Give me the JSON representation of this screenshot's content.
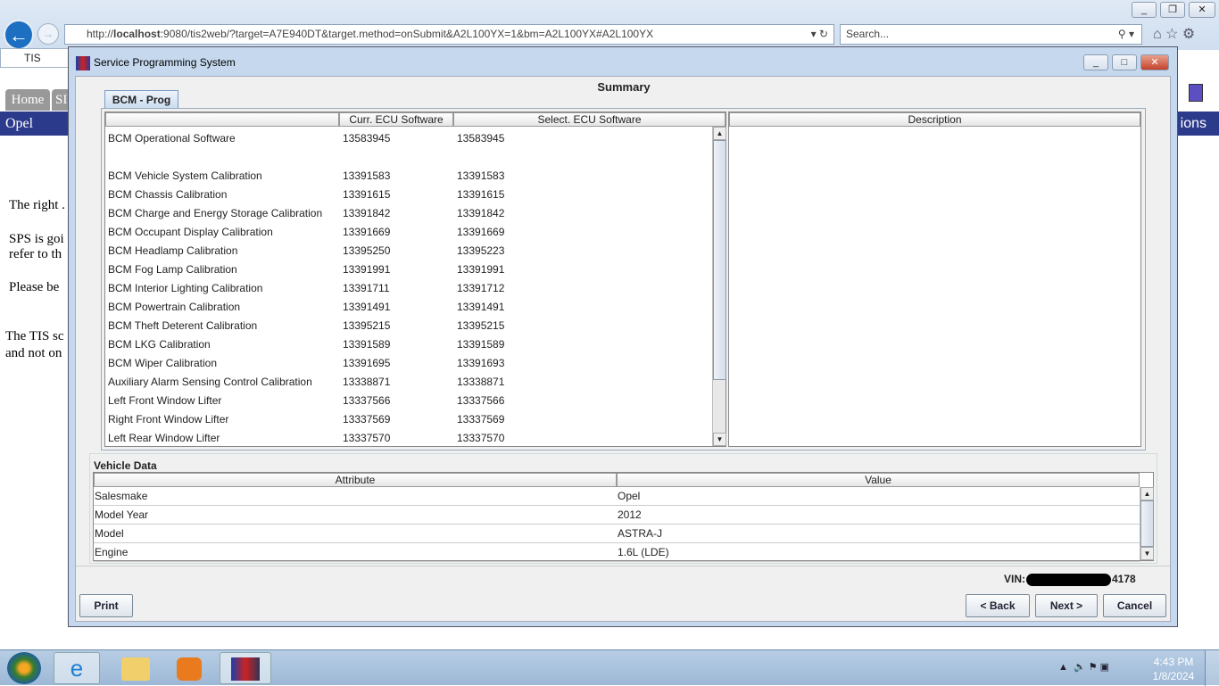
{
  "browser": {
    "url_prefix": "http://",
    "url_host": "localhost",
    "url_rest": ":9080/tis2web/?target=A7E940DT&target.method=onSubmit&A2L100YX=1&bm=A2L100YX#A2L100YX",
    "search_placeholder": "Search...",
    "tab_title": "TIS"
  },
  "page": {
    "tabs": [
      "Home",
      "SI"
    ],
    "brand": "Opel",
    "right_label": "ions",
    "paragraphs": [
      "The right .",
      "SPS is goi",
      "refer to th",
      "Please be ",
      "The TIS sc",
      "and not on"
    ]
  },
  "dialog": {
    "title": "Service Programming System",
    "heading": "Summary",
    "tab": "BCM - Prog",
    "software_table": {
      "headers": [
        "",
        "Curr. ECU Software",
        "Select. ECU Software"
      ],
      "rows": [
        [
          "BCM Operational Software",
          "13583945",
          "13583945"
        ],
        [
          "",
          "",
          ""
        ],
        [
          "BCM Vehicle System Calibration",
          "13391583",
          "13391583"
        ],
        [
          "BCM Chassis Calibration",
          "13391615",
          "13391615"
        ],
        [
          "BCM Charge and Energy Storage Calibration",
          "13391842",
          "13391842"
        ],
        [
          "BCM Occupant Display Calibration",
          "13391669",
          "13391669"
        ],
        [
          "BCM Headlamp Calibration",
          "13395250",
          "13395223"
        ],
        [
          "BCM Fog Lamp Calibration",
          "13391991",
          "13391991"
        ],
        [
          "BCM Interior Lighting Calibration",
          "13391711",
          "13391712"
        ],
        [
          "BCM Powertrain Calibration",
          "13391491",
          "13391491"
        ],
        [
          "BCM Theft Deterent Calibration",
          "13395215",
          "13395215"
        ],
        [
          "BCM LKG Calibration",
          "13391589",
          "13391589"
        ],
        [
          "BCM Wiper Calibration",
          "13391695",
          "13391693"
        ],
        [
          "Auxiliary Alarm Sensing Control Calibration",
          "13338871",
          "13338871"
        ],
        [
          "Left Front Window Lifter",
          "13337566",
          "13337566"
        ],
        [
          "Right Front Window Lifter",
          "13337569",
          "13337569"
        ],
        [
          "Left Rear Window Lifter",
          "13337570",
          "13337570"
        ]
      ]
    },
    "description_header": "Description",
    "vehicle_data": {
      "label": "Vehicle Data",
      "headers": [
        "Attribute",
        "Value"
      ],
      "rows": [
        [
          "Salesmake",
          "Opel"
        ],
        [
          "Model Year",
          "2012"
        ],
        [
          "Model",
          "ASTRA-J"
        ],
        [
          "Engine",
          "1.6L (LDE)"
        ]
      ]
    },
    "vin_label": "VIN:",
    "vin_suffix": "4178",
    "buttons": {
      "print": "Print",
      "back": "< Back",
      "next": "Next >",
      "cancel": "Cancel"
    }
  },
  "taskbar": {
    "time": "4:43 PM",
    "date": "1/8/2024"
  }
}
